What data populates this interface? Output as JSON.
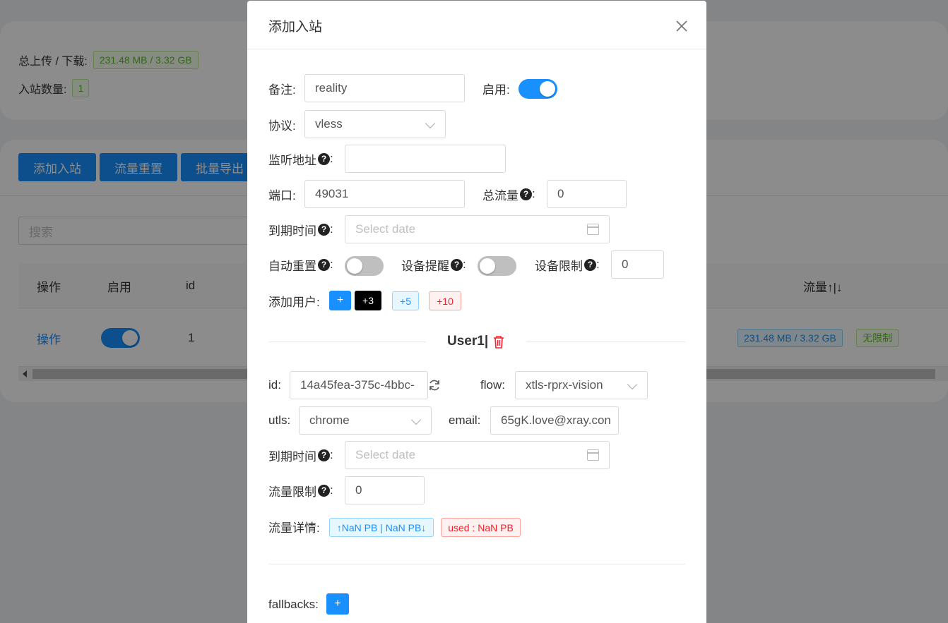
{
  "background": {
    "stats": {
      "traffic_label": "总上传 / 下载:",
      "traffic_value": "231.48 MB / 3.32 GB",
      "count_label": "入站数量:",
      "count_value": "1"
    },
    "buttons": {
      "add": "添加入站",
      "reset": "流量重置",
      "export": "批量导出"
    },
    "search_placeholder": "搜索",
    "table": {
      "headers": {
        "action": "操作",
        "enable": "启用",
        "id": "id",
        "traffic": "流量↑|↓"
      },
      "row": {
        "action": "操作",
        "id": "1",
        "traffic": "231.48 MB / 3.32 GB",
        "limit": "无限制"
      }
    }
  },
  "modal": {
    "title": "添加入站",
    "remark": {
      "label": "备注:",
      "value": "reality"
    },
    "enable": {
      "label": "启用:",
      "on": true
    },
    "protocol": {
      "label": "协议:",
      "value": "vless"
    },
    "listen": {
      "label": "监听地址",
      "value": ""
    },
    "port": {
      "label": "端口:",
      "value": "49031"
    },
    "total": {
      "label": "总流量",
      "value": "0"
    },
    "expiry": {
      "label": "到期时间",
      "placeholder": "Select date"
    },
    "auto_reset": {
      "label": "自动重置",
      "on": false
    },
    "device_alert": {
      "label": "设备提醒",
      "on": false
    },
    "device_limit": {
      "label": "设备限制",
      "value": "0"
    },
    "add_user": {
      "label": "添加用户:",
      "plus": "+",
      "plus3": "+3",
      "plus5": "+5",
      "plus10": "+10"
    },
    "user": {
      "title": "User1|",
      "id_label": "id:",
      "id_value": "14a45fea-375c-4bbc-",
      "flow_label": "flow:",
      "flow_value": "xtls-rprx-vision",
      "utls_label": "utls:",
      "utls_value": "chrome",
      "email_label": "email:",
      "email_value": "65gK.love@xray.con",
      "expiry_label": "到期时间",
      "expiry_placeholder": "Select date",
      "traffic_limit_label": "流量限制",
      "traffic_limit_value": "0",
      "traffic_detail_label": "流量详情:",
      "traffic_updown": "↑NaN PB | NaN PB↓",
      "traffic_used": "used : NaN PB"
    },
    "fallbacks": {
      "label": "fallbacks:",
      "plus": "+"
    }
  }
}
